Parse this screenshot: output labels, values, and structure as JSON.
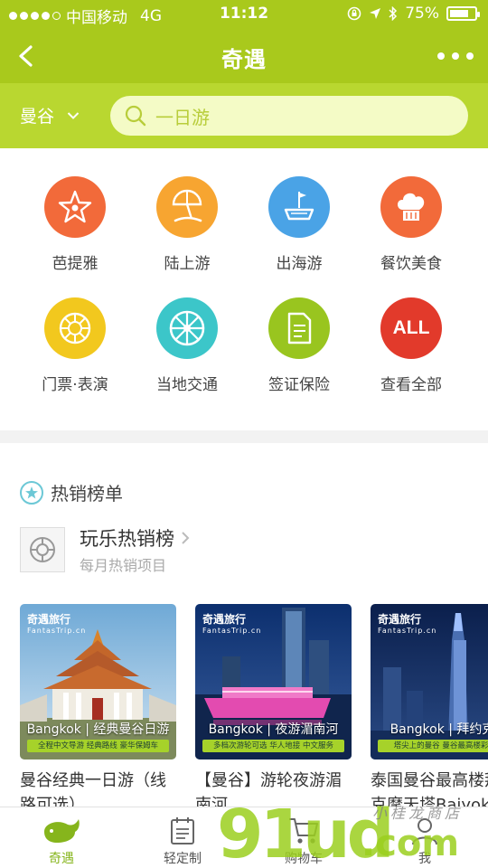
{
  "status": {
    "carrier": "中国移动",
    "network": "4G",
    "time": "11:12",
    "battery_text": "75%",
    "battery_level": 0.75
  },
  "nav": {
    "title": "奇遇",
    "back_icon": "chevron-left-icon",
    "more_icon": "more-dots-icon"
  },
  "search": {
    "city": "曼谷",
    "placeholder": "一日游"
  },
  "categories": [
    {
      "label": "芭提雅",
      "color": "#f26a3a",
      "icon": "star-icon"
    },
    {
      "label": "陆上游",
      "color": "#f7a531",
      "icon": "beach-umbrella-icon"
    },
    {
      "label": "出海游",
      "color": "#4aa3e6",
      "icon": "boat-icon"
    },
    {
      "label": "餐饮美食",
      "color": "#f26a3a",
      "icon": "chef-hat-icon"
    },
    {
      "label": "门票·表演",
      "color": "#f2c81e",
      "icon": "ticket-wheel-icon"
    },
    {
      "label": "当地交通",
      "color": "#3cc6c9",
      "icon": "wheel-icon"
    },
    {
      "label": "签证保险",
      "color": "#99c51f",
      "icon": "document-icon"
    },
    {
      "label": "查看全部",
      "color": "#e23a2b",
      "icon": "all-text-icon",
      "badge": "ALL"
    }
  ],
  "hot": {
    "section_title": "热销榜单",
    "ranking_title": "玩乐热销榜",
    "ranking_subtitle": "每月热销项目"
  },
  "cards": [
    {
      "logo": "奇遇旅行",
      "logo_sub": "FantasTrip.cn",
      "caption": "Bangkok | 经典曼谷日游",
      "strip": "全程中文导游 经典路线 豪华保姆车",
      "name": "曼谷经典一日游（线路可选）"
    },
    {
      "logo": "奇遇旅行",
      "logo_sub": "FantasTrip.cn",
      "caption": "Bangkok | 夜游湄南河",
      "strip": "多档次游轮可选 华人地接 中文服务",
      "name": "【曼谷】游轮夜游湄南河"
    },
    {
      "logo": "奇遇旅行",
      "logo_sub": "FantasTrip.cn",
      "caption": "Bangkok | 拜约克摩",
      "strip": "塔尖上的曼谷 曼谷最高楼彩虹云",
      "name": "泰国曼谷最高楼拜约克摩天塔Baiyok"
    }
  ],
  "tabs": [
    {
      "label": "奇遇",
      "icon": "whale-icon",
      "active": true
    },
    {
      "label": "轻定制",
      "icon": "calendar-icon",
      "active": false
    },
    {
      "label": "购物车",
      "icon": "cart-icon",
      "active": false
    },
    {
      "label": "我",
      "icon": "person-icon",
      "active": false
    }
  ],
  "watermark": {
    "digits": "91ud",
    "suffix": ".com",
    "script": "小桂龙商店"
  }
}
